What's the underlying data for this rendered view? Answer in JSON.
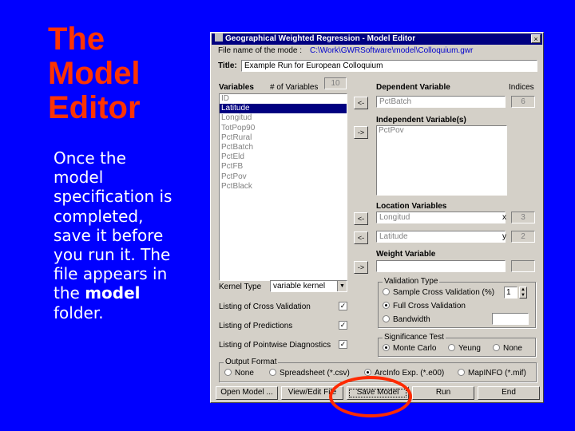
{
  "slide": {
    "title_lines": [
      "The",
      "Model",
      "Editor"
    ],
    "body_lines": [
      "Once the",
      "model",
      "specification is",
      "completed,",
      "save it before",
      "you run it. The",
      "file appears in"
    ],
    "body_last_pre": "the ",
    "body_last_bold": "model",
    "body_final": "folder."
  },
  "window": {
    "title": "Geographical Weighted Regression - Model Editor",
    "close_glyph": "×"
  },
  "editor": {
    "file_label": "File name of the mode :",
    "file_path": "C:\\Work\\GWRSoftware\\model\\Colloquium.gwr",
    "title_label": "Title:",
    "title_value": "Example Run for European Colloquium",
    "variables_label": "Variables",
    "num_vars_label": "# of Variables",
    "num_vars_value": "10",
    "variables": [
      "ID",
      "Latitude",
      "Longitud",
      "TotPop90",
      "PctRural",
      "PctBatch",
      "PctEld",
      "PctFB",
      "PctPov",
      "PctBlack"
    ],
    "selected_variable": "Latitude",
    "dependent_label": "Dependent Variable",
    "indices_label": "Indices",
    "dependent_value": "PctBatch",
    "dependent_index": "6",
    "independent_label": "Independent Variable(s)",
    "independent_values": [
      "PctPov"
    ],
    "location_label": "Location Variables",
    "loc_x_value": "Longitud",
    "loc_x_axis": "x",
    "loc_x_index": "3",
    "loc_y_value": "Latitude",
    "loc_y_axis": "y",
    "loc_y_index": "2",
    "weight_label": "Weight Variable",
    "weight_value": "",
    "weight_index": "",
    "arrow_left": "<-",
    "arrow_right": "->",
    "kernel_label": "Kernel Type",
    "kernel_value": "variable kernel",
    "listing_cv": "Listing of Cross Validation",
    "listing_pred": "Listing of Predictions",
    "listing_diag": "Listing of Pointwise Diagnostics",
    "check_glyph": "✓",
    "validation_title": "Validation Type",
    "val_sample": "Sample Cross Validation (%)",
    "val_sample_value": "1",
    "val_full": "Full Cross Validation",
    "val_bandwidth": "Bandwidth",
    "sig_title": "Significance Test",
    "sig_mc": "Monte Carlo",
    "sig_yeung": "Yeung",
    "sig_none": "None",
    "output_title": "Output Format",
    "out_none": "None",
    "out_spreadsheet": "Spreadsheet (*.csv)",
    "out_arcinfo": "ArcInfo Exp. (*.e00)",
    "out_mapinfo": "MapINFO (*.mif)",
    "btn_open": "Open Model ...",
    "btn_view": "View/Edit File",
    "btn_save": "Save Model",
    "btn_run": "Run",
    "btn_end": "End"
  }
}
